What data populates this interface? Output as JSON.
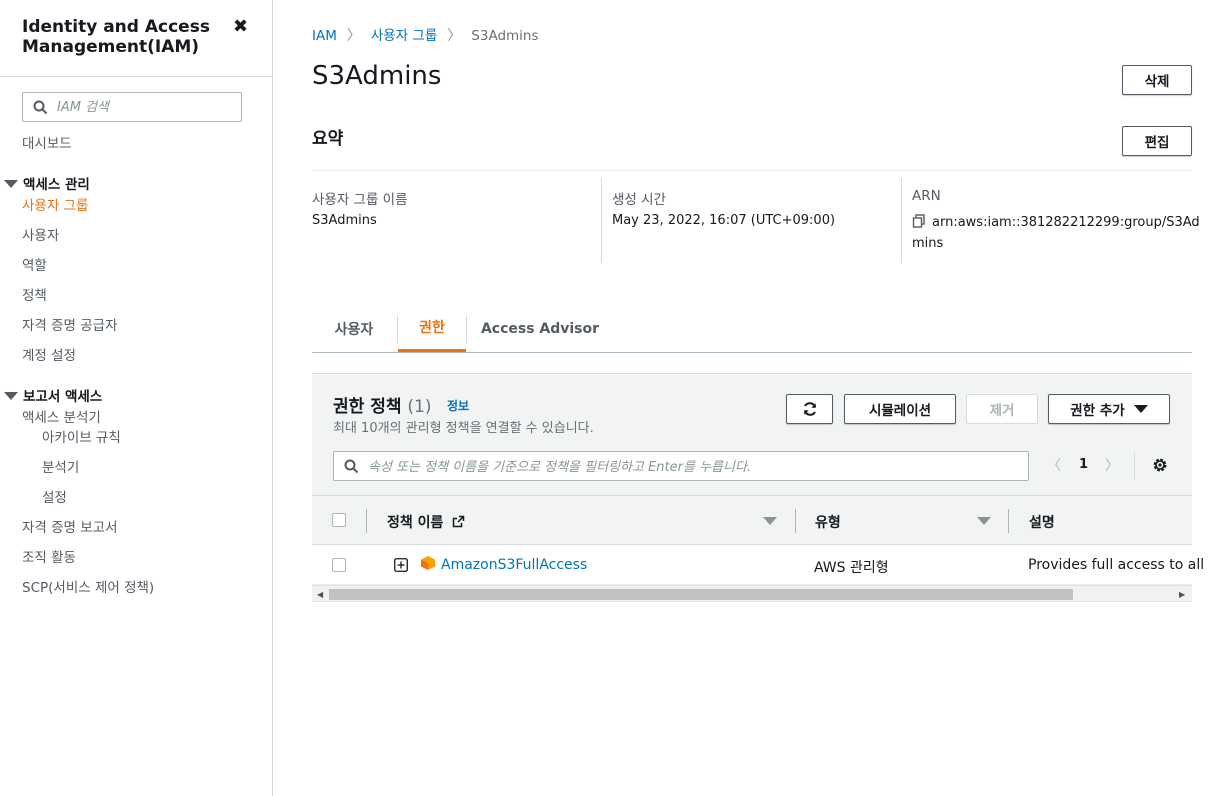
{
  "sidebar": {
    "title": "Identity and Access Management(IAM)",
    "search_placeholder": "IAM 검색",
    "dashboard": "대시보드",
    "section_access": "액세스 관리",
    "access_items": [
      "사용자 그룹",
      "사용자",
      "역할",
      "정책",
      "자격 증명 공급자",
      "계정 설정"
    ],
    "section_reports": "보고서 액세스",
    "analyzer": "액세스 분석기",
    "analyzer_items": [
      "아카이브 규칙",
      "분석기",
      "설정"
    ],
    "report_items": [
      "자격 증명 보고서",
      "조직 활동",
      "SCP(서비스 제어 정책)"
    ]
  },
  "breadcrumb": {
    "root": "IAM",
    "parent": "사용자 그룹",
    "current": "S3Admins"
  },
  "page": {
    "title": "S3Admins",
    "delete_label": "삭제",
    "summary_title": "요약",
    "edit_label": "편집"
  },
  "summary": {
    "name_label": "사용자 그룹 이름",
    "name_value": "S3Admins",
    "created_label": "생성 시간",
    "created_value": "May 23, 2022, 16:07 (UTC+09:00)",
    "arn_label": "ARN",
    "arn_line1": "arn:aws:iam::381282212299:group/S3Ad",
    "arn_line2": "mins"
  },
  "tabs": [
    "사용자",
    "권한",
    "Access Advisor"
  ],
  "policies": {
    "title": "권한 정책",
    "count": "(1)",
    "info": "정보",
    "description": "최대 10개의 관리형 정책을 연결할 수 있습니다.",
    "btn_simulate": "시뮬레이션",
    "btn_remove": "제거",
    "btn_add": "권한 추가",
    "filter_placeholder": "속성 또는 정책 이름을 기준으로 정책을 필터링하고 Enter를 누릅니다.",
    "page_number": "1",
    "columns": [
      "정책 이름",
      "유형",
      "설명"
    ],
    "rows": [
      {
        "name": "AmazonS3FullAccess",
        "type": "AWS 관리형",
        "description": "Provides full access to all"
      }
    ]
  },
  "colors": {
    "accent": "#ec7211",
    "link": "#0073bb"
  }
}
